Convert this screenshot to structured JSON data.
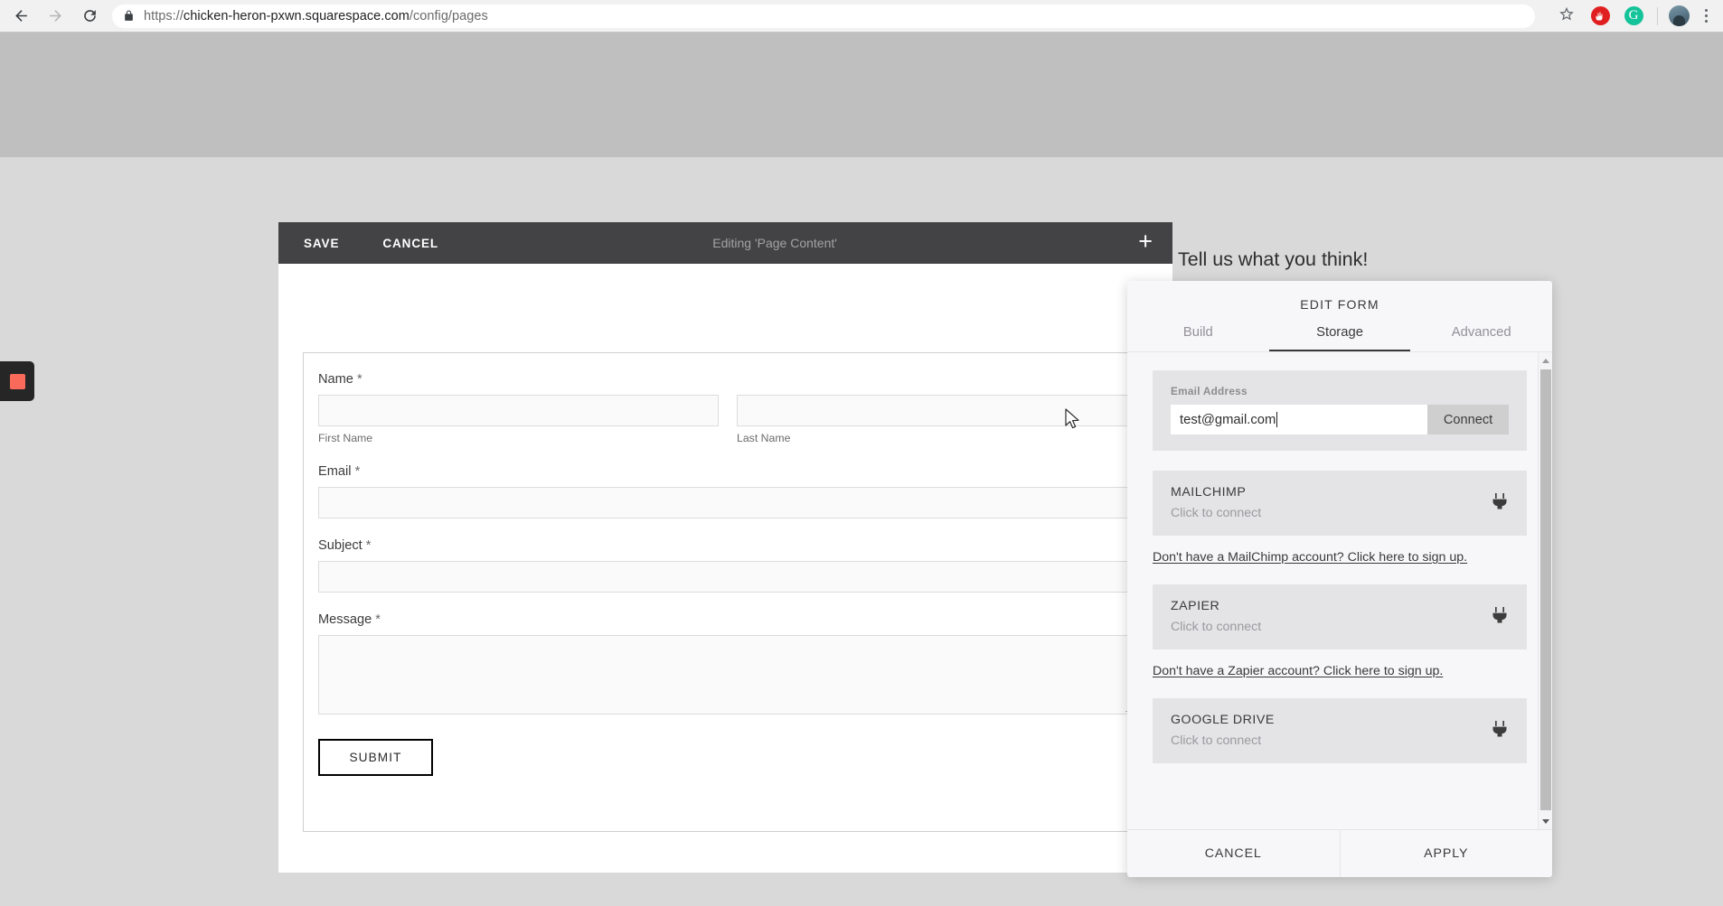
{
  "browser": {
    "back_icon": "back-arrow-icon",
    "forward_icon": "forward-arrow-icon",
    "reload_icon": "reload-icon",
    "lock_icon": "lock-icon",
    "url_scheme": "https://",
    "url_host": "chicken-heron-pxwn.squarespace.com",
    "url_path": "/config/pages",
    "bookmark_icon": "star-icon",
    "extension_1": "adblock-extension-icon",
    "extension_2_label": "G",
    "profile_icon": "profile-avatar-icon",
    "menu_icon": "three-dot-menu-icon"
  },
  "screenshare": {
    "indicator": "stop-recording-icon"
  },
  "editor_toolbar": {
    "save_label": "SAVE",
    "cancel_label": "CANCEL",
    "status": "Editing 'Page Content'",
    "add_icon": "plus-icon"
  },
  "site": {
    "heading": "Tell us what you think!"
  },
  "form": {
    "fields": [
      {
        "label": "Name",
        "required_marker": "*",
        "sub_first": "First Name",
        "sub_last": "Last Name"
      },
      {
        "label": "Email",
        "required_marker": "*"
      },
      {
        "label": "Subject",
        "required_marker": "*"
      },
      {
        "label": "Message",
        "required_marker": "*"
      }
    ],
    "submit_label": "SUBMIT"
  },
  "panel": {
    "title": "EDIT FORM",
    "tabs": [
      {
        "label": "Build",
        "active": false
      },
      {
        "label": "Storage",
        "active": true
      },
      {
        "label": "Advanced",
        "active": false
      }
    ],
    "email_section": {
      "label": "Email Address",
      "value": "test@gmail.com",
      "placeholder": "Email Address",
      "connect_label": "Connect"
    },
    "services": [
      {
        "name": "MAILCHIMP",
        "status": "Click to connect",
        "icon": "plug-icon",
        "signup_link": "Don't have a MailChimp account? Click here to sign up."
      },
      {
        "name": "ZAPIER",
        "status": "Click to connect",
        "icon": "plug-icon",
        "signup_link": "Don't have a Zapier account? Click here to sign up."
      },
      {
        "name": "GOOGLE DRIVE",
        "status": "Click to connect",
        "icon": "plug-icon",
        "signup_link": ""
      }
    ],
    "footer": {
      "cancel_label": "CANCEL",
      "apply_label": "APPLY"
    },
    "scrollbar": {
      "up_icon": "scroll-up-arrow-icon",
      "down_icon": "scroll-down-arrow-icon"
    }
  },
  "colors": {
    "toolbar_dark": "#434244",
    "panel_bg": "#f7f6f8",
    "card_bg": "#e4e3e5",
    "accent_red": "#f96a5a"
  }
}
